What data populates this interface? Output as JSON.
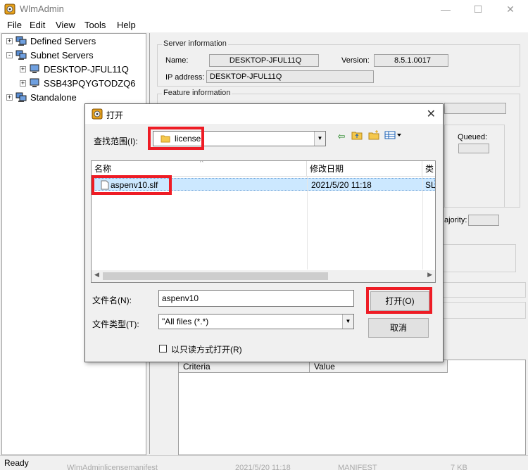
{
  "window": {
    "title": "WlmAdmin"
  },
  "menu": [
    "File",
    "Edit",
    "View",
    "Tools",
    "Help"
  ],
  "tree": [
    {
      "label": "Defined Servers",
      "expander": "+"
    },
    {
      "label": "Subnet Servers",
      "expander": "-"
    },
    {
      "label": "DESKTOP-JFUL11Q",
      "expander": "+"
    },
    {
      "label": "SSB43PQYGTODZQ6",
      "expander": "+"
    },
    {
      "label": "Standalone",
      "expander": "+"
    }
  ],
  "server_info": {
    "caption": "Server information",
    "name_label": "Name:",
    "name_value": "DESKTOP-JFUL11Q",
    "version_label": "Version:",
    "version_value": "8.5.1.0017",
    "ip_label": "IP address:",
    "ip_value": "DESKTOP-JFUL11Q"
  },
  "feature_info": {
    "caption": "Feature information",
    "queued_label": "Queued:",
    "majority_label": "ajority:"
  },
  "criteria_table": {
    "headers": [
      "Criteria",
      "Value"
    ]
  },
  "status": {
    "text": "Ready",
    "ghost_cols": [
      "WlmAdminlicensemanifest",
      "2021/5/20 11:18",
      "MANIFEST",
      "7 KB"
    ]
  },
  "dialog": {
    "title": "打开",
    "lookin_label": "查找范围(I):",
    "lookin_value": "license",
    "columns": [
      "名称",
      "修改日期",
      "类"
    ],
    "file": {
      "name": "aspenv10.slf",
      "date": "2021/5/20 11:18",
      "type": "SL"
    },
    "filename_label": "文件名(N):",
    "filename_value": "aspenv10",
    "filetype_label": "文件类型(T):",
    "filetype_value": "\"All files (*.*)",
    "readonly_label": "以只读方式打开(R)",
    "open_button": "打开(O)",
    "cancel_button": "取消"
  },
  "colors": {
    "highlight": "#ee1c25",
    "selection": "#cce8ff"
  }
}
